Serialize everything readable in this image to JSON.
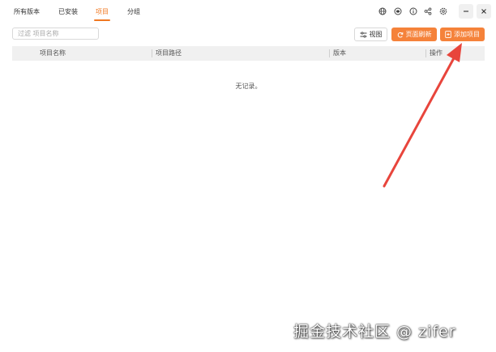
{
  "tabs": [
    {
      "label": "所有版本",
      "active": false
    },
    {
      "label": "已安装",
      "active": false
    },
    {
      "label": "项目",
      "active": true
    },
    {
      "label": "分组",
      "active": false
    }
  ],
  "toolbar_icons": [
    "globe-icon",
    "github-icon",
    "info-icon",
    "share-icon",
    "settings-icon"
  ],
  "filter": {
    "placeholder": "过滤 项目名称",
    "value": ""
  },
  "buttons": {
    "view": "视图",
    "refresh": "页面刷新",
    "add": "添加项目"
  },
  "table": {
    "columns": [
      "项目名称",
      "项目路径",
      "版本",
      "操作"
    ],
    "rows": [],
    "empty_text": "无记录。"
  },
  "watermark": "掘金技术社区 @ zifer",
  "colors": {
    "accent": "#f5823a",
    "active_tab": "#f07822",
    "arrow": "#e8453c"
  }
}
